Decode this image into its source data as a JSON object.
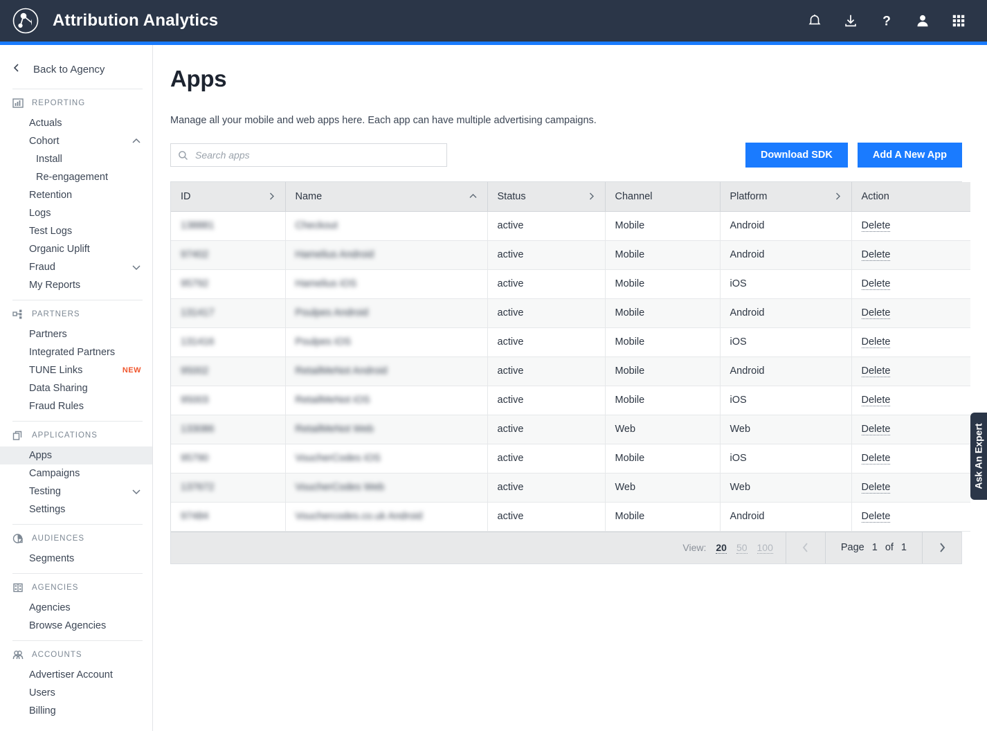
{
  "header": {
    "brand_title": "Attribution Analytics",
    "icons": [
      {
        "name": "notifications-icon",
        "label": "bell-icon"
      },
      {
        "name": "download-icon",
        "label": "download-icon"
      },
      {
        "name": "help-icon",
        "label": "question-mark-icon"
      },
      {
        "name": "account-icon",
        "label": "person-icon"
      },
      {
        "name": "apps-grid-icon",
        "label": "grid-icon"
      }
    ],
    "accent_color": "#1a7bff",
    "background_color": "#2b3648"
  },
  "sidebar": {
    "back_label": "Back to Agency",
    "groups": [
      {
        "label": "REPORTING",
        "icon": "bar-chart-icon",
        "items": [
          {
            "label": "Actuals",
            "sub": false,
            "chevron": "",
            "badge": "",
            "active": false
          },
          {
            "label": "Cohort",
            "sub": false,
            "chevron": "up",
            "badge": "",
            "active": false
          },
          {
            "label": "Install",
            "sub": true,
            "chevron": "",
            "badge": "",
            "active": false
          },
          {
            "label": "Re-engagement",
            "sub": true,
            "chevron": "",
            "badge": "",
            "active": false
          },
          {
            "label": "Retention",
            "sub": false,
            "chevron": "",
            "badge": "",
            "active": false
          },
          {
            "label": "Logs",
            "sub": false,
            "chevron": "",
            "badge": "",
            "active": false
          },
          {
            "label": "Test Logs",
            "sub": false,
            "chevron": "",
            "badge": "",
            "active": false
          },
          {
            "label": "Organic Uplift",
            "sub": false,
            "chevron": "",
            "badge": "",
            "active": false
          },
          {
            "label": "Fraud",
            "sub": false,
            "chevron": "down",
            "badge": "",
            "active": false
          },
          {
            "label": "My Reports",
            "sub": false,
            "chevron": "",
            "badge": "",
            "active": false
          }
        ]
      },
      {
        "label": "PARTNERS",
        "icon": "partners-icon",
        "items": [
          {
            "label": "Partners",
            "sub": false,
            "chevron": "",
            "badge": "",
            "active": false
          },
          {
            "label": "Integrated Partners",
            "sub": false,
            "chevron": "",
            "badge": "",
            "active": false
          },
          {
            "label": "TUNE Links",
            "sub": false,
            "chevron": "",
            "badge": "NEW",
            "active": false
          },
          {
            "label": "Data Sharing",
            "sub": false,
            "chevron": "",
            "badge": "",
            "active": false
          },
          {
            "label": "Fraud Rules",
            "sub": false,
            "chevron": "",
            "badge": "",
            "active": false
          }
        ]
      },
      {
        "label": "APPLICATIONS",
        "icon": "applications-icon",
        "items": [
          {
            "label": "Apps",
            "sub": false,
            "chevron": "",
            "badge": "",
            "active": true
          },
          {
            "label": "Campaigns",
            "sub": false,
            "chevron": "",
            "badge": "",
            "active": false
          },
          {
            "label": "Testing",
            "sub": false,
            "chevron": "down",
            "badge": "",
            "active": false
          },
          {
            "label": "Settings",
            "sub": false,
            "chevron": "",
            "badge": "",
            "active": false
          }
        ]
      },
      {
        "label": "AUDIENCES",
        "icon": "audiences-icon",
        "items": [
          {
            "label": "Segments",
            "sub": false,
            "chevron": "",
            "badge": "",
            "active": false
          }
        ]
      },
      {
        "label": "AGENCIES",
        "icon": "agencies-icon",
        "items": [
          {
            "label": "Agencies",
            "sub": false,
            "chevron": "",
            "badge": "",
            "active": false
          },
          {
            "label": "Browse Agencies",
            "sub": false,
            "chevron": "",
            "badge": "",
            "active": false
          }
        ]
      },
      {
        "label": "ACCOUNTS",
        "icon": "accounts-icon",
        "items": [
          {
            "label": "Advertiser Account",
            "sub": false,
            "chevron": "",
            "badge": "",
            "active": false
          },
          {
            "label": "Users",
            "sub": false,
            "chevron": "",
            "badge": "",
            "active": false
          },
          {
            "label": "Billing",
            "sub": false,
            "chevron": "",
            "badge": "",
            "active": false
          }
        ]
      }
    ]
  },
  "main": {
    "title": "Apps",
    "description": "Manage all your mobile and web apps here. Each app can have multiple advertising campaigns.",
    "search": {
      "value": "",
      "placeholder": "Search apps"
    },
    "buttons": {
      "download_sdk": "Download SDK",
      "add_new_app": "Add A New App"
    },
    "table": {
      "columns": [
        {
          "label": "ID",
          "sort": "right",
          "key": "id"
        },
        {
          "label": "Name",
          "sort": "up",
          "key": "name"
        },
        {
          "label": "Status",
          "sort": "right",
          "key": "status"
        },
        {
          "label": "Channel",
          "sort": "",
          "key": "channel"
        },
        {
          "label": "Platform",
          "sort": "right",
          "key": "platform"
        },
        {
          "label": "Action",
          "sort": "",
          "key": "action"
        }
      ],
      "action_label": "Delete",
      "rows": [
        {
          "id": "138881",
          "name": "Checkout",
          "status": "active",
          "channel": "Mobile",
          "platform": "Android"
        },
        {
          "id": "97402",
          "name": "Hamelius Android",
          "status": "active",
          "channel": "Mobile",
          "platform": "Android"
        },
        {
          "id": "95792",
          "name": "Hamelius iOS",
          "status": "active",
          "channel": "Mobile",
          "platform": "iOS"
        },
        {
          "id": "131417",
          "name": "Poulpes Android",
          "status": "active",
          "channel": "Mobile",
          "platform": "Android"
        },
        {
          "id": "131416",
          "name": "Poulpes iOS",
          "status": "active",
          "channel": "Mobile",
          "platform": "iOS"
        },
        {
          "id": "95002",
          "name": "RetailMeNot Android",
          "status": "active",
          "channel": "Mobile",
          "platform": "Android"
        },
        {
          "id": "95003",
          "name": "RetailMeNot iOS",
          "status": "active",
          "channel": "Mobile",
          "platform": "iOS"
        },
        {
          "id": "133086",
          "name": "RetailMeNot Web",
          "status": "active",
          "channel": "Web",
          "platform": "Web"
        },
        {
          "id": "95790",
          "name": "VoucherCodes iOS",
          "status": "active",
          "channel": "Mobile",
          "platform": "iOS"
        },
        {
          "id": "137672",
          "name": "VoucherCodes Web",
          "status": "active",
          "channel": "Web",
          "platform": "Web"
        },
        {
          "id": "97484",
          "name": "Vouchercodes.co.uk Android",
          "status": "active",
          "channel": "Mobile",
          "platform": "Android"
        }
      ]
    },
    "pagination": {
      "view_label": "View:",
      "view_options": [
        "20",
        "50",
        "100"
      ],
      "view_selected": "20",
      "page_label": "Page",
      "page_current": "1",
      "page_of": "of",
      "page_total": "1"
    }
  },
  "side_tab": {
    "label": "Ask An Expert"
  }
}
